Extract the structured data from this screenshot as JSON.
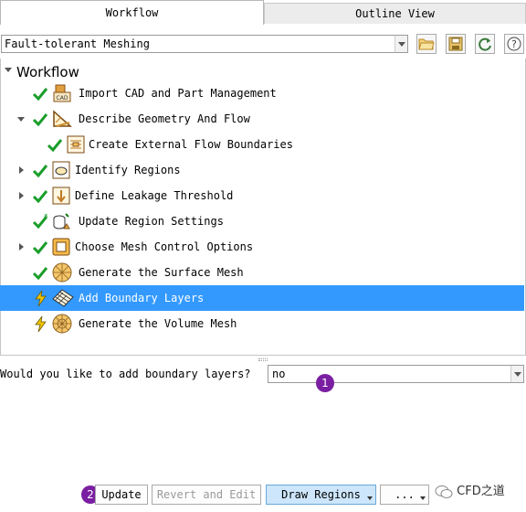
{
  "tabs": {
    "workflow": "Workflow",
    "outline": "Outline View"
  },
  "workflow_type": {
    "value": "Fault-tolerant Meshing"
  },
  "toolbar": {
    "open": "folder-open-icon",
    "save": "save-icon",
    "refresh": "refresh-icon",
    "help": "help-icon"
  },
  "tree": {
    "root": "Workflow",
    "items": [
      {
        "label": "Import CAD and Part Management",
        "status": "check",
        "icon": "cad-import-icon"
      },
      {
        "label": "Describe Geometry And Flow",
        "status": "check",
        "icon": "geometry-flow-icon"
      },
      {
        "label": "Create External Flow Boundaries",
        "status": "check",
        "icon": "flow-boundaries-icon"
      },
      {
        "label": "Identify Regions",
        "status": "check",
        "icon": "regions-icon"
      },
      {
        "label": "Define Leakage Threshold",
        "status": "check",
        "icon": "leakage-icon"
      },
      {
        "label": "Update Region Settings",
        "status": "check-modified",
        "icon": "region-settings-icon"
      },
      {
        "label": "Choose Mesh Control Options",
        "status": "check",
        "icon": "mesh-control-icon"
      },
      {
        "label": "Generate the Surface Mesh",
        "status": "check",
        "icon": "surface-mesh-icon"
      },
      {
        "label": "Add Boundary Layers",
        "status": "pending",
        "icon": "boundary-layers-icon"
      },
      {
        "label": "Generate the Volume Mesh",
        "status": "pending",
        "icon": "volume-mesh-icon"
      }
    ]
  },
  "task": {
    "question": "Would you like to add boundary layers?",
    "answer": "no"
  },
  "badges": {
    "one": "1",
    "two": "2"
  },
  "buttons": {
    "update": "Update",
    "revert": "Revert and Edit",
    "draw_regions": "Draw Regions",
    "more": "..."
  },
  "watermark": "CFD之道",
  "colors": {
    "selection": "#3399ff",
    "check": "#1a9e2a",
    "pending": "#f2c500",
    "badge": "#7a1fa2"
  }
}
